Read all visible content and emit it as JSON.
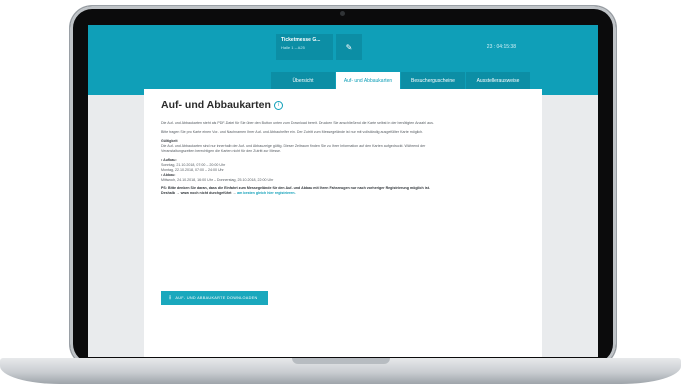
{
  "header": {
    "event_name": "Ticketmesse G...",
    "event_location": "Halle 1 – A25",
    "edit_icon": "pencil-icon",
    "countdown": "23 : 04:15:38"
  },
  "tabs": [
    {
      "label": "Übersicht",
      "active": false
    },
    {
      "label": "Auf- und Abbaukarten",
      "active": true
    },
    {
      "label": "Besucherguscheine",
      "active": false
    },
    {
      "label": "Ausstellerausweise",
      "active": false
    }
  ],
  "page": {
    "title": "Auf- und Abbaukarten",
    "title_icon": "info-icon",
    "intro": "Die Auf- und Abbaukarten steht als PDF-Datei für Sie über den Button unten zum Download bereit. Drucken Sie anschließend die Karte selbst in der benötigten Anzahl aus.",
    "instruction": "Bitte tragen Sie pro Karte einen Vor- und Nachnamen Ihrer Auf- und Abbauhelfer ein. Der Zutritt zum Messegelände ist nur mit vollständig ausgefüllter Karte möglich.",
    "validity_heading": "Gültigkeit",
    "validity_text": "Die Auf- und Abbaukarten sind nur innerhalb der Auf- und Abbauzeige gültig. Dieser Zeitraum finden Sie zu Ihrer Information auf den Karten aufgedruckt. Während der Veranstaltungszeiten berechtigen die Karten nicht für den Zutritt zur Messe.",
    "setup_label": "Aufbau:",
    "setup_line1": "Sonntag, 21.10.2018, 07:00 – 20:00 Uhr",
    "setup_line2": "Montag, 22.10.2018, 07:00 – 24:00 Uhr",
    "teardown_label": "Abbau:",
    "teardown_line1": "Mittwoch, 24.10.2018, 16:00 Uhr – Donnerstag, 25.10.2018, 22:00 Uhr",
    "ps_text": "PS: Bitte denken Sie daran, dass die Einfahrt zum Messegelände für den Auf- und Abbau mit Ihren Fahrzeugen nur nach vorheriger Registrierung möglich ist. Deshalb → www noch nicht durchgeführt →",
    "ps_link": "am besten gleich hier registrieren.",
    "download_button": "AUF- UND ABBAUKARTE DOWNLOADEN",
    "download_icon": "download-icon"
  }
}
